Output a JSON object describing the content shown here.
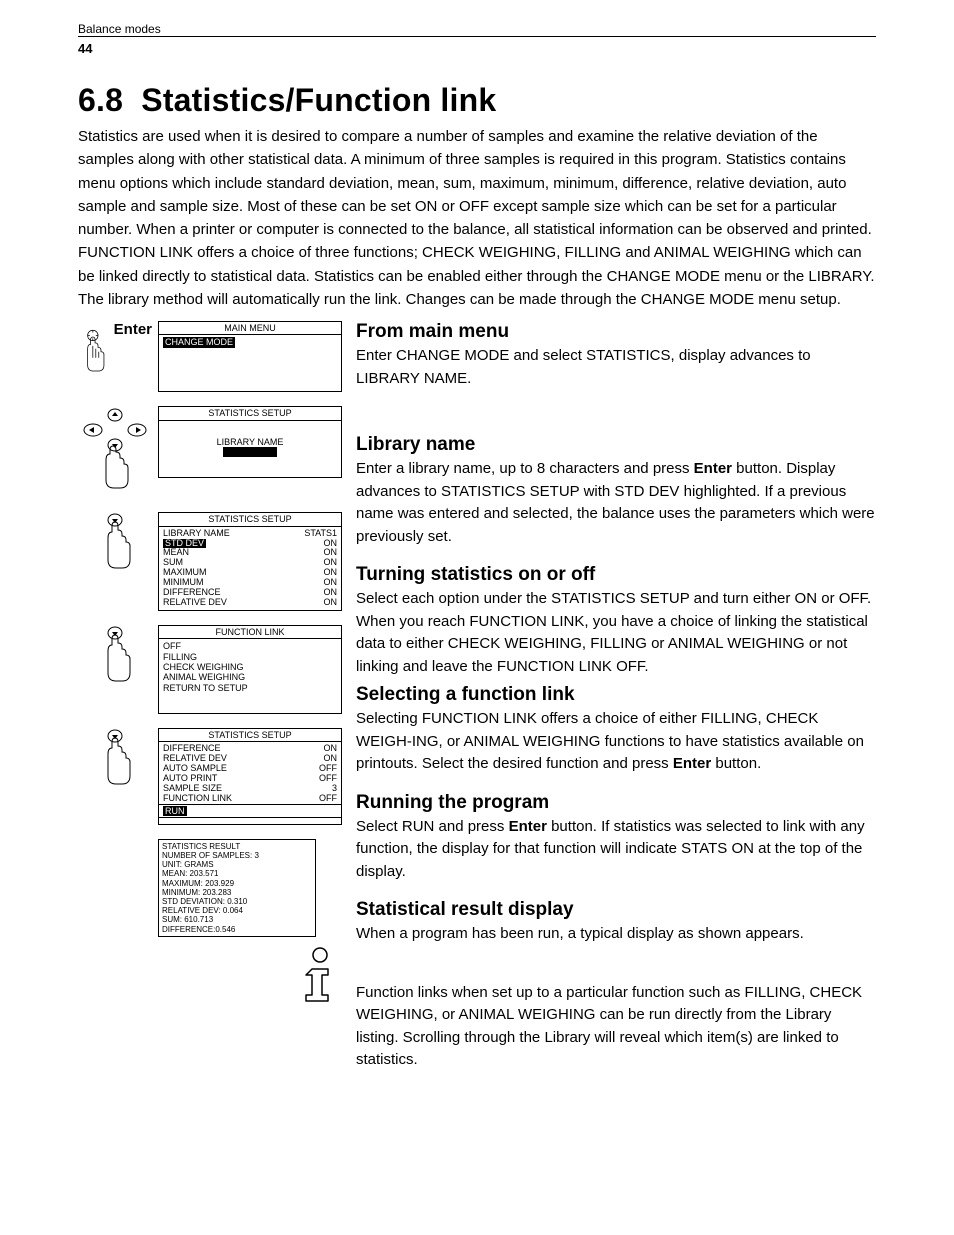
{
  "header": {
    "chapter": "Balance modes",
    "page": "44"
  },
  "title_num": "6.8",
  "title_text": "Statistics/Function link",
  "intro": "Statistics are used when it is desired to compare a number of samples and examine the relative deviation of the samples along with other statistical data. A minimum of three samples is required in this program. Statistics contains menu options which include standard deviation, mean, sum, maximum, minimum, difference, relative deviation, auto sample and sample size. Most of these can be set ON or OFF except sample size which can be set for a particular number. When a printer or computer is connected to the balance, all statistical information can be observed and printed. FUNCTION LINK offers a choice of three functions; CHECK WEIGHING, FILLING and ANIMAL WEIGHING which can be linked directly to statistical data. Statistics can be enabled either through the CHANGE MODE menu or the LIBRARY. The library method will automatically run the link. Changes can be made through the CHANGE MODE menu setup.",
  "steps": {
    "enter_label": "Enter",
    "main_menu": {
      "title": "MAIN MENU",
      "item": "CHANGE MODE"
    },
    "stats_setup_1": {
      "title": "STATISTICS SETUP",
      "item": "LIBRARY NAME"
    },
    "stats_setup_2": {
      "title": "STATISTICS  SETUP",
      "rows": [
        [
          "LIBRARY NAME",
          "STATS1"
        ],
        [
          "STD DEV",
          "ON"
        ],
        [
          "MEAN",
          "ON"
        ],
        [
          "SUM",
          "ON"
        ],
        [
          "MAXIMUM",
          "ON"
        ],
        [
          "MINIMUM",
          "ON"
        ],
        [
          "DIFFERENCE",
          "ON"
        ],
        [
          "RELATIVE DEV",
          "ON"
        ]
      ]
    },
    "func_link": {
      "title": "FUNCTION LINK",
      "rows": [
        "OFF",
        "FILLING",
        "CHECK WEIGHING",
        "ANIMAL WEIGHING",
        "RETURN TO SETUP"
      ]
    },
    "stats_setup_3": {
      "title": "STATISTICS  SETUP",
      "rows": [
        [
          "DIFFERENCE",
          "ON"
        ],
        [
          "RELATIVE DEV",
          "ON"
        ],
        [
          "AUTO SAMPLE",
          "OFF"
        ],
        [
          "AUTO PRINT",
          "OFF"
        ],
        [
          "SAMPLE SIZE",
          "3"
        ],
        [
          "FUNCTION LINK",
          "OFF"
        ]
      ],
      "run": "RUN"
    },
    "result": [
      "STATISTICS RESULT",
      "NUMBER OF SAMPLES: 3",
      "UNIT: GRAMS",
      "MEAN: 203.571",
      "MAXIMUM: 203.929",
      "MINIMUM: 203.283",
      "STD DEVIATION: 0.310",
      "RELATIVE DEV: 0.064",
      "SUM: 610.713",
      "DIFFERENCE:0.546"
    ]
  },
  "sections": {
    "s1": {
      "h": "From main menu",
      "p": "Enter CHANGE MODE and select STATISTICS, display advances to LIBRARY NAME."
    },
    "s2": {
      "h": "Library name",
      "p1": "Enter a library name, up to 8 characters and press ",
      "b": "Enter",
      "p2": " button. Display advances to STATISTICS SETUP with STD DEV highlighted. If a previous name was entered and selected, the balance uses the parameters which were previously set."
    },
    "s3": {
      "h": "Turning statistics on or off",
      "p": "Select each option under the STATISTICS SETUP and turn either ON or OFF. When you reach FUNCTION LINK, you have a choice of linking the statistical data to either CHECK WEIGHING, FILLING or ANIMAL WEIGHING or not linking and leave the FUNCTION LINK OFF."
    },
    "s4": {
      "h": "Selecting a function link",
      "p1": "Selecting FUNCTION LINK offers a choice of either FILLING, CHECK WEIGH-ING, or ANIMAL WEIGHING functions to have statistics available on printouts. Select the desired function and press ",
      "b": "Enter",
      "p2": " button."
    },
    "s5": {
      "h": "Running the program",
      "p1": "Select RUN and press ",
      "b": "Enter",
      "p2": " button. If statistics was selected to link with any function, the display for that function will indicate STATS ON at the top of the display."
    },
    "s6": {
      "h": "Statistical result display",
      "p": "When a program has been run, a typical display as shown appears."
    },
    "s7": {
      "p": "Function links when set up to a particular function such as FILLING, CHECK WEIGHING, or ANIMAL WEIGHING can be run directly from the Library listing. Scrolling through the Library will reveal which item(s) are linked to statistics."
    }
  }
}
